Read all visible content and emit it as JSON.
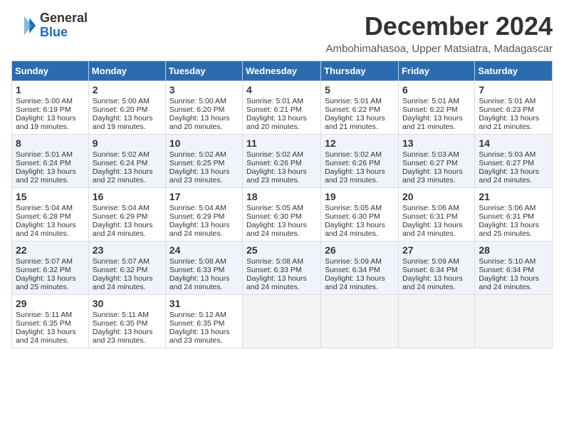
{
  "logo": {
    "line1": "General",
    "line2": "Blue"
  },
  "title": "December 2024",
  "subtitle": "Ambohimahasoa, Upper Matsiatra, Madagascar",
  "days_of_week": [
    "Sunday",
    "Monday",
    "Tuesday",
    "Wednesday",
    "Thursday",
    "Friday",
    "Saturday"
  ],
  "weeks": [
    [
      {
        "day": 1,
        "sunrise": "5:00 AM",
        "sunset": "6:19 PM",
        "daylight": "13 hours and 19 minutes."
      },
      {
        "day": 2,
        "sunrise": "5:00 AM",
        "sunset": "6:20 PM",
        "daylight": "13 hours and 19 minutes."
      },
      {
        "day": 3,
        "sunrise": "5:00 AM",
        "sunset": "6:20 PM",
        "daylight": "13 hours and 20 minutes."
      },
      {
        "day": 4,
        "sunrise": "5:01 AM",
        "sunset": "6:21 PM",
        "daylight": "13 hours and 20 minutes."
      },
      {
        "day": 5,
        "sunrise": "5:01 AM",
        "sunset": "6:22 PM",
        "daylight": "13 hours and 21 minutes."
      },
      {
        "day": 6,
        "sunrise": "5:01 AM",
        "sunset": "6:22 PM",
        "daylight": "13 hours and 21 minutes."
      },
      {
        "day": 7,
        "sunrise": "5:01 AM",
        "sunset": "6:23 PM",
        "daylight": "13 hours and 21 minutes."
      }
    ],
    [
      {
        "day": 8,
        "sunrise": "5:01 AM",
        "sunset": "6:24 PM",
        "daylight": "13 hours and 22 minutes."
      },
      {
        "day": 9,
        "sunrise": "5:02 AM",
        "sunset": "6:24 PM",
        "daylight": "13 hours and 22 minutes."
      },
      {
        "day": 10,
        "sunrise": "5:02 AM",
        "sunset": "6:25 PM",
        "daylight": "13 hours and 23 minutes."
      },
      {
        "day": 11,
        "sunrise": "5:02 AM",
        "sunset": "6:26 PM",
        "daylight": "13 hours and 23 minutes."
      },
      {
        "day": 12,
        "sunrise": "5:02 AM",
        "sunset": "6:26 PM",
        "daylight": "13 hours and 23 minutes."
      },
      {
        "day": 13,
        "sunrise": "5:03 AM",
        "sunset": "6:27 PM",
        "daylight": "13 hours and 23 minutes."
      },
      {
        "day": 14,
        "sunrise": "5:03 AM",
        "sunset": "6:27 PM",
        "daylight": "13 hours and 24 minutes."
      }
    ],
    [
      {
        "day": 15,
        "sunrise": "5:04 AM",
        "sunset": "6:28 PM",
        "daylight": "13 hours and 24 minutes."
      },
      {
        "day": 16,
        "sunrise": "5:04 AM",
        "sunset": "6:29 PM",
        "daylight": "13 hours and 24 minutes."
      },
      {
        "day": 17,
        "sunrise": "5:04 AM",
        "sunset": "6:29 PM",
        "daylight": "13 hours and 24 minutes."
      },
      {
        "day": 18,
        "sunrise": "5:05 AM",
        "sunset": "6:30 PM",
        "daylight": "13 hours and 24 minutes."
      },
      {
        "day": 19,
        "sunrise": "5:05 AM",
        "sunset": "6:30 PM",
        "daylight": "13 hours and 24 minutes."
      },
      {
        "day": 20,
        "sunrise": "5:06 AM",
        "sunset": "6:31 PM",
        "daylight": "13 hours and 24 minutes."
      },
      {
        "day": 21,
        "sunrise": "5:06 AM",
        "sunset": "6:31 PM",
        "daylight": "13 hours and 25 minutes."
      }
    ],
    [
      {
        "day": 22,
        "sunrise": "5:07 AM",
        "sunset": "6:32 PM",
        "daylight": "13 hours and 25 minutes."
      },
      {
        "day": 23,
        "sunrise": "5:07 AM",
        "sunset": "6:32 PM",
        "daylight": "13 hours and 24 minutes."
      },
      {
        "day": 24,
        "sunrise": "5:08 AM",
        "sunset": "6:33 PM",
        "daylight": "13 hours and 24 minutes."
      },
      {
        "day": 25,
        "sunrise": "5:08 AM",
        "sunset": "6:33 PM",
        "daylight": "13 hours and 24 minutes."
      },
      {
        "day": 26,
        "sunrise": "5:09 AM",
        "sunset": "6:34 PM",
        "daylight": "13 hours and 24 minutes."
      },
      {
        "day": 27,
        "sunrise": "5:09 AM",
        "sunset": "6:34 PM",
        "daylight": "13 hours and 24 minutes."
      },
      {
        "day": 28,
        "sunrise": "5:10 AM",
        "sunset": "6:34 PM",
        "daylight": "13 hours and 24 minutes."
      }
    ],
    [
      {
        "day": 29,
        "sunrise": "5:11 AM",
        "sunset": "6:35 PM",
        "daylight": "13 hours and 24 minutes."
      },
      {
        "day": 30,
        "sunrise": "5:11 AM",
        "sunset": "6:35 PM",
        "daylight": "13 hours and 23 minutes."
      },
      {
        "day": 31,
        "sunrise": "5:12 AM",
        "sunset": "6:35 PM",
        "daylight": "13 hours and 23 minutes."
      },
      null,
      null,
      null,
      null
    ]
  ]
}
